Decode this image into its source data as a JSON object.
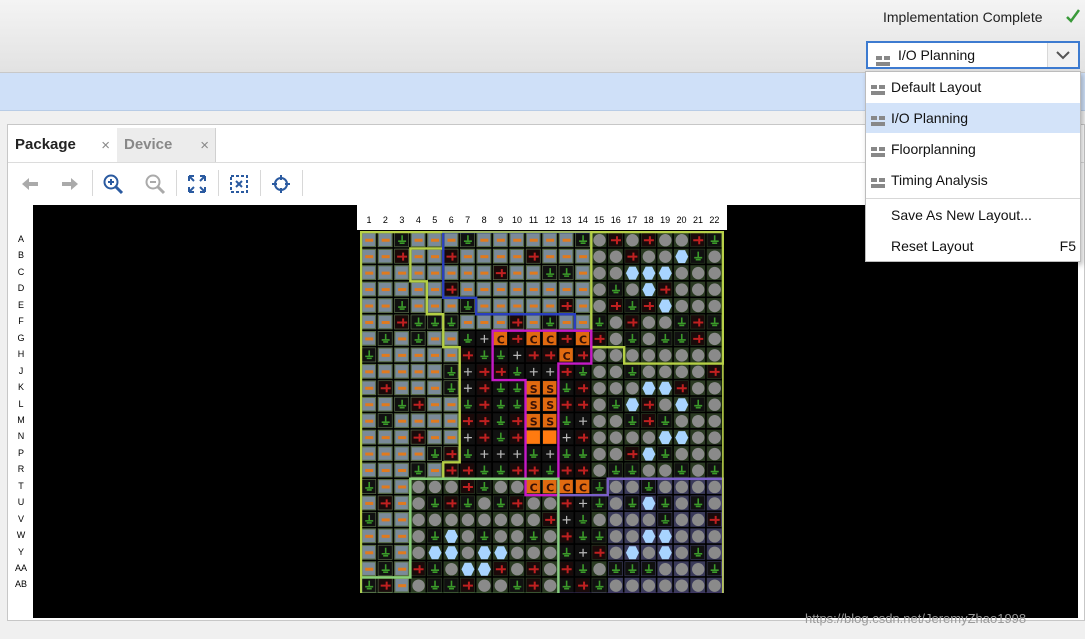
{
  "header": {
    "status_text": "Implementation Complete",
    "status_icon": "checkmark-icon",
    "status_color": "#3a9a3a",
    "layout_selected": "I/O Planning"
  },
  "layout_menu": {
    "items": [
      {
        "label": "Default Layout",
        "icon": "layout-icon",
        "selected": false
      },
      {
        "label": "I/O Planning",
        "icon": "layout-icon",
        "selected": true
      },
      {
        "label": "Floorplanning",
        "icon": "layout-icon",
        "selected": false
      },
      {
        "label": "Timing Analysis",
        "icon": "layout-icon",
        "selected": false
      },
      {
        "label": "Save As New Layout...",
        "icon": "",
        "selected": false
      },
      {
        "label": "Reset Layout",
        "icon": "",
        "shortcut": "F5",
        "selected": false
      }
    ]
  },
  "tabs": [
    {
      "label": "Package",
      "active": true
    },
    {
      "label": "Device",
      "active": false
    }
  ],
  "toolbar": {
    "buttons": [
      "back-icon",
      "forward-icon",
      "zoom-in-icon",
      "zoom-out-icon",
      "fit-to-view-icon",
      "zoom-selection-icon",
      "locate-icon"
    ]
  },
  "package": {
    "column_labels": [
      "1",
      "2",
      "3",
      "4",
      "5",
      "6",
      "7",
      "8",
      "9",
      "10",
      "11",
      "12",
      "13",
      "14",
      "15",
      "16",
      "17",
      "18",
      "19",
      "20",
      "21",
      "22"
    ],
    "row_labels": [
      "A",
      "B",
      "C",
      "D",
      "E",
      "F",
      "G",
      "H",
      "J",
      "K",
      "L",
      "M",
      "N",
      "P",
      "R",
      "T",
      "U",
      "V",
      "W",
      "Y",
      "AA",
      "AB"
    ],
    "special_pin_labels": {
      "config": "C",
      "system": "S"
    },
    "colors": {
      "background": "#000000",
      "bank_left": "#b5d045",
      "bank_blue": "#2a3fc0",
      "bank_purple": "#7a5fc8",
      "bank_magenta": "#c51ac6",
      "bank_bottom": "#86d07a",
      "io_pin": "#7a8a99",
      "io_marker": "#e07a1e",
      "ground": "#3b9a2a",
      "power": "#c02020",
      "hex_pin": "#a8d4ff"
    }
  },
  "watermark": "https://blog.csdn.net/JeremyZhao1998"
}
